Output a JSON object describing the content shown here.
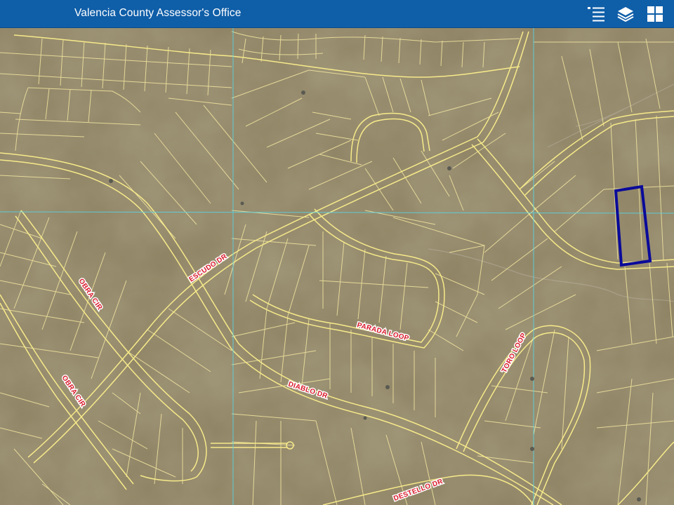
{
  "header": {
    "title": "Valencia County Assessor's Office",
    "background": "#0f5ea8",
    "buttons": [
      {
        "name": "legend",
        "icon": "legend-list-icon"
      },
      {
        "name": "layers",
        "icon": "layers-icon"
      },
      {
        "name": "basemap-gallery",
        "icon": "grid-icon"
      }
    ]
  },
  "map": {
    "basemap": "satellite imagery",
    "parcel_line_color": "#f2e6a0",
    "road_color": "#f7ea8a",
    "section_line_color": "#5ad2e0",
    "selected_parcel_color": "#0a0a9a",
    "street_labels": {
      "escudo": "ESCUDO DR",
      "obra1": "OBRA CIR",
      "obra2": "OBRA CIR",
      "parada": "PARADA LOOP",
      "diablo": "DIABLO DR",
      "toro": "TORO LOOP",
      "destello": "DESTELLO DR"
    }
  }
}
